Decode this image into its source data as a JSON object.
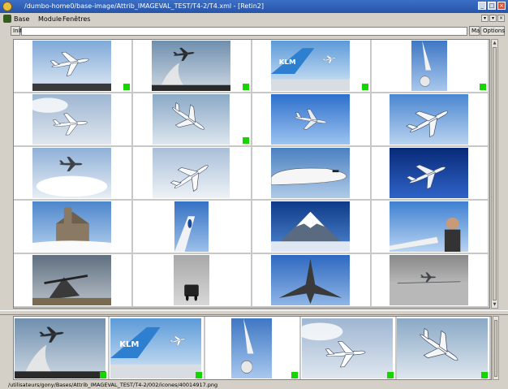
{
  "window": {
    "title": "/dumbo-home0/base-image/Attrib_IMAGEVAL_TEST/T4-2/T4.xml - [Retin2]",
    "controls": [
      "_",
      "□",
      "×"
    ]
  },
  "menubar": {
    "items": [
      "Base",
      "Module",
      "Fenêtres"
    ],
    "mdi_controls": [
      "▾",
      "▾",
      "×"
    ]
  },
  "toolbar": {
    "init_label": "Init",
    "path_value": "",
    "ma_label": "Ma",
    "options_label": "Options"
  },
  "results_grid": {
    "rows": 5,
    "cols": 4,
    "items": [
      {
        "subject": "Concorde airliner on takeoff",
        "selected": true
      },
      {
        "subject": "Fighter jet firing flares",
        "selected": true
      },
      {
        "subject": "KLM airliner tail and aircraft on apron",
        "selected": true
      },
      {
        "subject": "Airliner tail fins with engines",
        "selected": true
      },
      {
        "subject": "White airliner in flight under clouds",
        "selected": false
      },
      {
        "subject": "Airliner climbing, viewed from below",
        "selected": true
      },
      {
        "subject": "US Airways airliner in blue sky",
        "selected": false
      },
      {
        "subject": "Airliner banking, close up",
        "selected": false
      },
      {
        "subject": "Military jet over white smoke",
        "selected": false
      },
      {
        "subject": "Airliner climbing in pale sky",
        "selected": false
      },
      {
        "subject": "Airliner nose and cockpit",
        "selected": false
      },
      {
        "subject": "Airliner in deep blue sky",
        "selected": false
      },
      {
        "subject": "Stone chapel in snow",
        "selected": false
      },
      {
        "subject": "Airliner tail with logo, vertical",
        "selected": false
      },
      {
        "subject": "Snow-capped volcano above clouds",
        "selected": false
      },
      {
        "subject": "Man in front of airliner tail",
        "selected": false
      },
      {
        "subject": "Vintage biplane crash",
        "selected": false
      },
      {
        "subject": "Old car on street, black and white",
        "selected": false
      },
      {
        "subject": "Concorde seen from below",
        "selected": false
      },
      {
        "subject": "Flooded airfield, black and white",
        "selected": false
      }
    ]
  },
  "basket": {
    "items": [
      {
        "subject": "Fighter jet firing flares",
        "selected": true
      },
      {
        "subject": "KLM airliner tail and aircraft on apron",
        "selected": true
      },
      {
        "subject": "Airliner tail fins with engines",
        "selected": true
      },
      {
        "subject": "White airliner in flight under clouds",
        "selected": true
      },
      {
        "subject": "Airliner climbing, viewed from below",
        "selected": true
      }
    ]
  },
  "statusbar": {
    "text": "/utilisateurs/gony/Bases/Attrib_IMAGEVAL_TEST/T4-2/002/icones/40014917.png"
  },
  "colors": {
    "titlebar": "#2654a8",
    "selection_badge": "#16d400",
    "window_bg": "#d4d0c8"
  }
}
